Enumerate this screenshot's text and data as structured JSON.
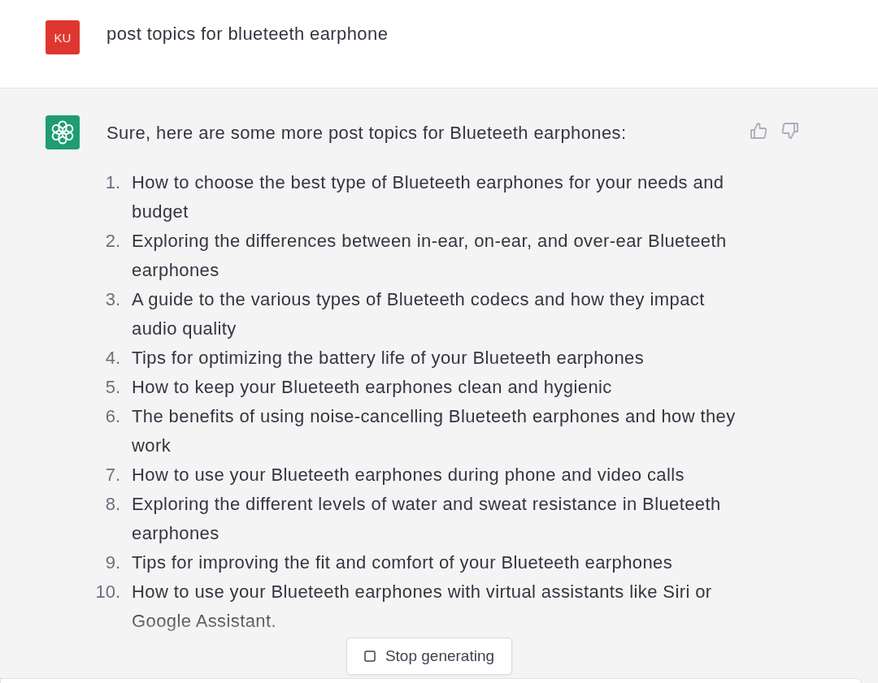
{
  "user_message": {
    "avatar_initials": "KU",
    "text": "post topics for blueteeth earphone"
  },
  "assistant_message": {
    "intro": "Sure, here are some more post topics for Blueteeth earphones:",
    "items": [
      {
        "number": "1.",
        "text": "How to choose the best type of Blueteeth earphones for your needs and budget"
      },
      {
        "number": "2.",
        "text": "Exploring the differences between in-ear, on-ear, and over-ear Blueteeth earphones"
      },
      {
        "number": "3.",
        "text": "A guide to the various types of Blueteeth codecs and how they impact audio quality"
      },
      {
        "number": "4.",
        "text": "Tips for optimizing the battery life of your Blueteeth earphones"
      },
      {
        "number": "5.",
        "text": "How to keep your Blueteeth earphones clean and hygienic"
      },
      {
        "number": "6.",
        "text": "The benefits of using noise-cancelling Blueteeth earphones and how they work"
      },
      {
        "number": "7.",
        "text": "How to use your Blueteeth earphones during phone and video calls"
      },
      {
        "number": "8.",
        "text": "Exploring the different levels of water and sweat resistance in Blueteeth earphones"
      },
      {
        "number": "9.",
        "text": "Tips for improving the fit and comfort of your Blueteeth earphones"
      },
      {
        "number": "10.",
        "text": "How to use your Blueteeth earphones with virtual assistants like Siri or Google Assistant."
      }
    ]
  },
  "stop_button": {
    "label": "Stop generating"
  }
}
